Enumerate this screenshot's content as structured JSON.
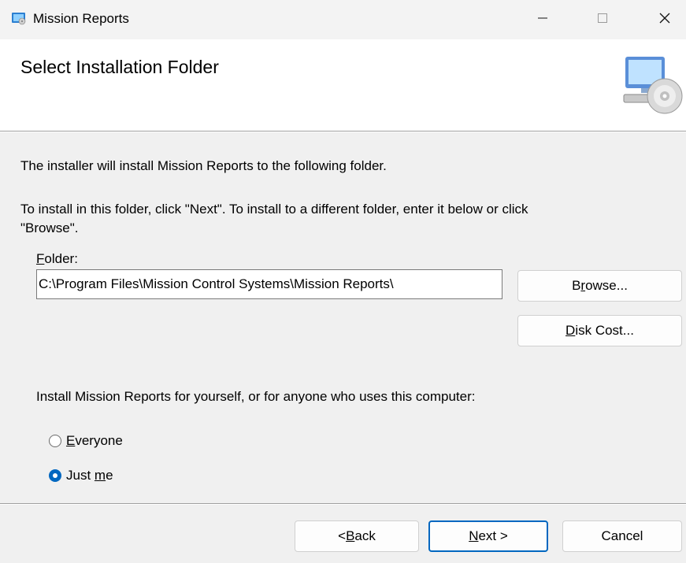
{
  "window": {
    "title": "Mission Reports",
    "minimize_glyph": "—",
    "maximize_glyph": "☐",
    "close_glyph": "✕",
    "app_icon": "installer-icon"
  },
  "header": {
    "title": "Select Installation Folder",
    "icon": "computer-disc-icon"
  },
  "body": {
    "intro": "The installer will install Mission Reports to the following folder.",
    "instructions_line1": "To install in this folder, click \"Next\". To install to a different folder, enter it below or click",
    "instructions_line2": "\"Browse\".",
    "folder_label_accel": "F",
    "folder_label_rest": "older:",
    "folder_value": "C:\\Program Files\\Mission Control Systems\\Mission Reports\\",
    "browse": {
      "pre": "B",
      "accel": "r",
      "post": "owse..."
    },
    "disk_cost": {
      "pre": "",
      "accel": "D",
      "post": "isk Cost..."
    },
    "install_for_prompt": "Install Mission Reports for yourself, or for anyone who uses this computer:",
    "radio_everyone": {
      "accel": "E",
      "rest": "veryone",
      "selected": false
    },
    "radio_just_me": {
      "pre": "Just ",
      "accel": "m",
      "post": "e",
      "selected": true
    }
  },
  "footer": {
    "back": {
      "pre": "< ",
      "accel": "B",
      "post": "ack"
    },
    "next": {
      "pre": "",
      "accel": "N",
      "post": "ext >"
    },
    "cancel": "Cancel"
  },
  "colors": {
    "accent": "#0067c0",
    "dialog_bg": "#f0f0f0",
    "header_bg": "#ffffff"
  }
}
